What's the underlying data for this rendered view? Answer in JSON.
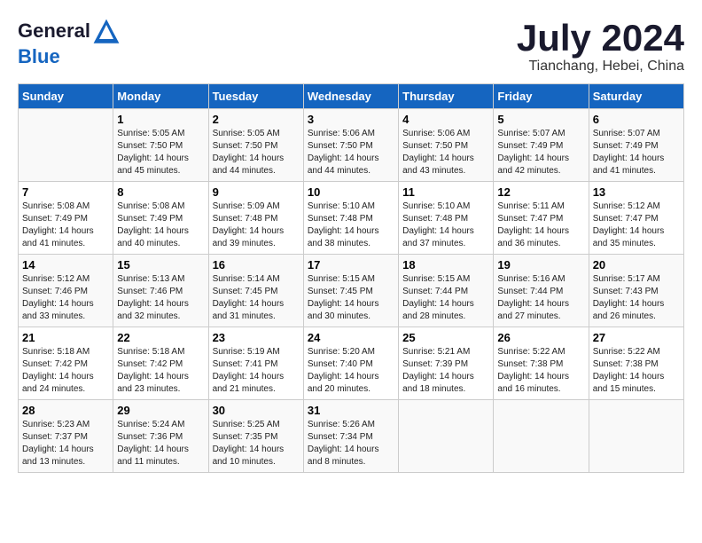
{
  "header": {
    "logo_line1": "General",
    "logo_line2": "Blue",
    "month_title": "July 2024",
    "subtitle": "Tianchang, Hebei, China"
  },
  "weekdays": [
    "Sunday",
    "Monday",
    "Tuesday",
    "Wednesday",
    "Thursday",
    "Friday",
    "Saturday"
  ],
  "weeks": [
    [
      {
        "day": "",
        "content": ""
      },
      {
        "day": "1",
        "content": "Sunrise: 5:05 AM\nSunset: 7:50 PM\nDaylight: 14 hours\nand 45 minutes."
      },
      {
        "day": "2",
        "content": "Sunrise: 5:05 AM\nSunset: 7:50 PM\nDaylight: 14 hours\nand 44 minutes."
      },
      {
        "day": "3",
        "content": "Sunrise: 5:06 AM\nSunset: 7:50 PM\nDaylight: 14 hours\nand 44 minutes."
      },
      {
        "day": "4",
        "content": "Sunrise: 5:06 AM\nSunset: 7:50 PM\nDaylight: 14 hours\nand 43 minutes."
      },
      {
        "day": "5",
        "content": "Sunrise: 5:07 AM\nSunset: 7:49 PM\nDaylight: 14 hours\nand 42 minutes."
      },
      {
        "day": "6",
        "content": "Sunrise: 5:07 AM\nSunset: 7:49 PM\nDaylight: 14 hours\nand 41 minutes."
      }
    ],
    [
      {
        "day": "7",
        "content": "Sunrise: 5:08 AM\nSunset: 7:49 PM\nDaylight: 14 hours\nand 41 minutes."
      },
      {
        "day": "8",
        "content": "Sunrise: 5:08 AM\nSunset: 7:49 PM\nDaylight: 14 hours\nand 40 minutes."
      },
      {
        "day": "9",
        "content": "Sunrise: 5:09 AM\nSunset: 7:48 PM\nDaylight: 14 hours\nand 39 minutes."
      },
      {
        "day": "10",
        "content": "Sunrise: 5:10 AM\nSunset: 7:48 PM\nDaylight: 14 hours\nand 38 minutes."
      },
      {
        "day": "11",
        "content": "Sunrise: 5:10 AM\nSunset: 7:48 PM\nDaylight: 14 hours\nand 37 minutes."
      },
      {
        "day": "12",
        "content": "Sunrise: 5:11 AM\nSunset: 7:47 PM\nDaylight: 14 hours\nand 36 minutes."
      },
      {
        "day": "13",
        "content": "Sunrise: 5:12 AM\nSunset: 7:47 PM\nDaylight: 14 hours\nand 35 minutes."
      }
    ],
    [
      {
        "day": "14",
        "content": "Sunrise: 5:12 AM\nSunset: 7:46 PM\nDaylight: 14 hours\nand 33 minutes."
      },
      {
        "day": "15",
        "content": "Sunrise: 5:13 AM\nSunset: 7:46 PM\nDaylight: 14 hours\nand 32 minutes."
      },
      {
        "day": "16",
        "content": "Sunrise: 5:14 AM\nSunset: 7:45 PM\nDaylight: 14 hours\nand 31 minutes."
      },
      {
        "day": "17",
        "content": "Sunrise: 5:15 AM\nSunset: 7:45 PM\nDaylight: 14 hours\nand 30 minutes."
      },
      {
        "day": "18",
        "content": "Sunrise: 5:15 AM\nSunset: 7:44 PM\nDaylight: 14 hours\nand 28 minutes."
      },
      {
        "day": "19",
        "content": "Sunrise: 5:16 AM\nSunset: 7:44 PM\nDaylight: 14 hours\nand 27 minutes."
      },
      {
        "day": "20",
        "content": "Sunrise: 5:17 AM\nSunset: 7:43 PM\nDaylight: 14 hours\nand 26 minutes."
      }
    ],
    [
      {
        "day": "21",
        "content": "Sunrise: 5:18 AM\nSunset: 7:42 PM\nDaylight: 14 hours\nand 24 minutes."
      },
      {
        "day": "22",
        "content": "Sunrise: 5:18 AM\nSunset: 7:42 PM\nDaylight: 14 hours\nand 23 minutes."
      },
      {
        "day": "23",
        "content": "Sunrise: 5:19 AM\nSunset: 7:41 PM\nDaylight: 14 hours\nand 21 minutes."
      },
      {
        "day": "24",
        "content": "Sunrise: 5:20 AM\nSunset: 7:40 PM\nDaylight: 14 hours\nand 20 minutes."
      },
      {
        "day": "25",
        "content": "Sunrise: 5:21 AM\nSunset: 7:39 PM\nDaylight: 14 hours\nand 18 minutes."
      },
      {
        "day": "26",
        "content": "Sunrise: 5:22 AM\nSunset: 7:38 PM\nDaylight: 14 hours\nand 16 minutes."
      },
      {
        "day": "27",
        "content": "Sunrise: 5:22 AM\nSunset: 7:38 PM\nDaylight: 14 hours\nand 15 minutes."
      }
    ],
    [
      {
        "day": "28",
        "content": "Sunrise: 5:23 AM\nSunset: 7:37 PM\nDaylight: 14 hours\nand 13 minutes."
      },
      {
        "day": "29",
        "content": "Sunrise: 5:24 AM\nSunset: 7:36 PM\nDaylight: 14 hours\nand 11 minutes."
      },
      {
        "day": "30",
        "content": "Sunrise: 5:25 AM\nSunset: 7:35 PM\nDaylight: 14 hours\nand 10 minutes."
      },
      {
        "day": "31",
        "content": "Sunrise: 5:26 AM\nSunset: 7:34 PM\nDaylight: 14 hours\nand 8 minutes."
      },
      {
        "day": "",
        "content": ""
      },
      {
        "day": "",
        "content": ""
      },
      {
        "day": "",
        "content": ""
      }
    ]
  ]
}
